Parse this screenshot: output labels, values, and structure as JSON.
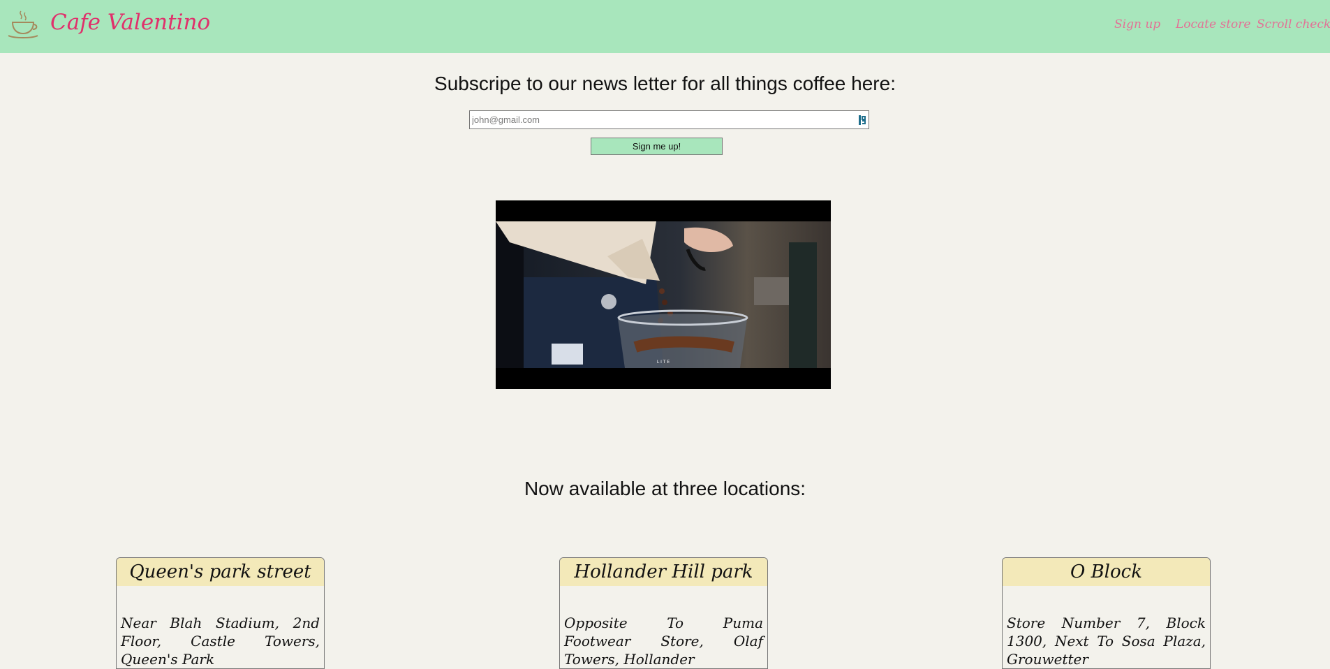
{
  "header": {
    "brand": "Cafe Valentino",
    "logo_icon": "coffee-cup-icon",
    "nav": [
      "Sign up",
      "Locate store",
      "Scroll check"
    ]
  },
  "subscribe": {
    "title": "Subscripe to our news letter for all things coffee here:",
    "email_placeholder": "john@gmail.com",
    "button_label": "Sign me up!"
  },
  "video": {
    "caption": "L I T E"
  },
  "locations": {
    "title": "Now available at three locations:",
    "stores": [
      {
        "name": "Queen's park street",
        "address": "Near Blah Stadium, 2nd Floor, Castle Towers, Queen's Park"
      },
      {
        "name": "Hollander Hill park",
        "address": "Opposite To Puma Footwear Store, Olaf Towers, Hollander"
      },
      {
        "name": "O Block",
        "address": "Store Number 7, Block 1300, Next To Sosa Plaza, Grouwetter"
      }
    ]
  },
  "colors": {
    "header_bg": "#a8e6bc",
    "brand": "#e0306b",
    "nav_link": "#e27196",
    "page_bg": "#f3f2ec",
    "card_header_bg": "#f3e9b9"
  }
}
